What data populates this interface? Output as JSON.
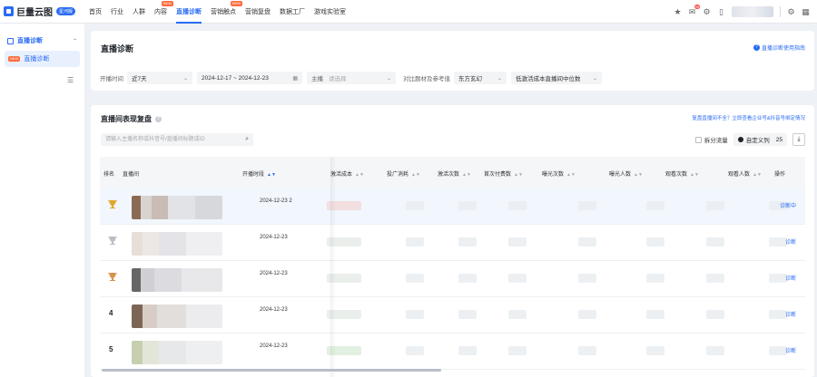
{
  "topnav": {
    "logo_text": "巨量云图",
    "logo_badge": "星河版",
    "items": [
      {
        "label": "首页",
        "active": false,
        "new": ""
      },
      {
        "label": "行业",
        "active": false,
        "new": ""
      },
      {
        "label": "人群",
        "active": false,
        "new": ""
      },
      {
        "label": "内容",
        "active": false,
        "new": "NEW"
      },
      {
        "label": "直播诊断",
        "active": true,
        "new": ""
      },
      {
        "label": "营销触点",
        "active": false,
        "new": "NEW"
      },
      {
        "label": "营销复盘",
        "active": false,
        "new": ""
      },
      {
        "label": "数据工厂",
        "active": false,
        "new": ""
      },
      {
        "label": "游戏实验室",
        "active": false,
        "new": ""
      }
    ],
    "icons": [
      "star-icon",
      "message-icon",
      "settings-icon",
      "device-icon"
    ],
    "message_badge": "99",
    "colors": {
      "accent": "#2a6bf2",
      "new_badge": "#ff6a3d"
    }
  },
  "sidebar": {
    "section_label": "直播诊断",
    "item_label": "直播诊断",
    "item_badge": "NEW"
  },
  "header": {
    "title": "直播诊断",
    "guide_link": "直播诊断使用指南"
  },
  "filters": {
    "time_label": "开播时间",
    "time_value": "近7天",
    "date_range": "2024-12-17 ~ 2024-12-23",
    "anchor_label": "主播",
    "anchor_placeholder": "请选择",
    "compare_label": "对比题材及参考值",
    "compare_value": "东方玄幻",
    "metric_value": "低激活成本直播间中位数"
  },
  "table_section": {
    "title": "直播间表现复盘",
    "help_link": "复盘直播间不全？立即查看企业号&抖音号绑定情况",
    "search_placeholder": "请输入主播名称或抖音号/直播间标题或ID",
    "split_flow_label": "拆分流量",
    "custom_col_label": "自定义列",
    "custom_col_count": "25",
    "columns": [
      {
        "label": "排名",
        "sort": ""
      },
      {
        "label": "直播间",
        "sort": ""
      },
      {
        "label": "开播时段",
        "sort": "▲▼"
      },
      {
        "label": "激活成本",
        "sort": "▲▼"
      },
      {
        "label": "投广消耗",
        "sort": "▲▼"
      },
      {
        "label": "激活次数",
        "sort": "▲▼"
      },
      {
        "label": "首次付费数",
        "sort": "▲▼"
      },
      {
        "label": "曝光次数",
        "sort": "▲▼"
      },
      {
        "label": "曝光人数",
        "sort": "▲▼"
      },
      {
        "label": "观看次数",
        "sort": "▲▼"
      },
      {
        "label": "观看人数",
        "sort": "▲▼"
      },
      {
        "label": "操作",
        "sort": ""
      }
    ],
    "rows": [
      {
        "rank": "",
        "trophy": "gold",
        "time": "2024-12-23 2",
        "action": "诊断中"
      },
      {
        "rank": "",
        "trophy": "silver",
        "time": "2024-12-23",
        "action": "诊断"
      },
      {
        "rank": "",
        "trophy": "bronze",
        "time": "2024-12-23",
        "action": "诊断"
      },
      {
        "rank": "4",
        "trophy": "",
        "time": "2024-12-23",
        "action": "诊断"
      },
      {
        "rank": "5",
        "trophy": "",
        "time": "2024-12-23",
        "action": "诊断"
      }
    ]
  }
}
